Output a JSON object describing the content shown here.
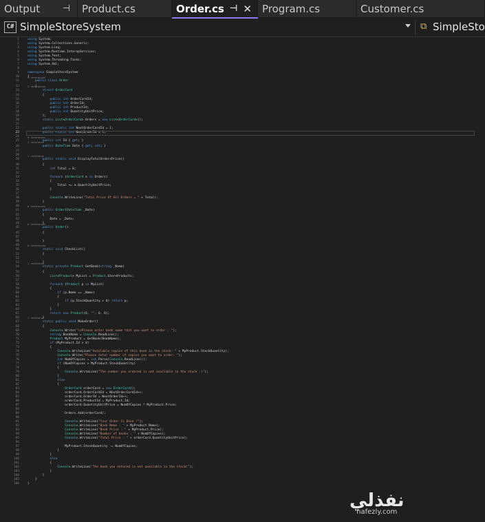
{
  "tabs": [
    {
      "label": "Output",
      "active": false,
      "pin": "⊣",
      "close": ""
    },
    {
      "label": "Product.cs",
      "active": false,
      "pin": "",
      "close": ""
    },
    {
      "label": "Order.cs",
      "active": true,
      "pin": "⊣",
      "close": "✕"
    },
    {
      "label": "Program.cs",
      "active": false,
      "pin": "",
      "close": ""
    },
    {
      "label": "Customer.cs",
      "active": false,
      "pin": "",
      "close": ""
    }
  ],
  "navbar": {
    "project": "SimpleStoreSystem",
    "cs_badge": "C#",
    "class_label": "SimpleStore"
  },
  "watermark": {
    "arabic": "نفذلي",
    "latin": "nafezly.com"
  },
  "current_line": 23,
  "code_lines": [
    {
      "n": 1,
      "t": "using System;"
    },
    {
      "n": 2,
      "t": "using System.Collections.Generic;"
    },
    {
      "n": 3,
      "t": "using System.Linq;"
    },
    {
      "n": 4,
      "t": "using System.Runtime.InteropServices;"
    },
    {
      "n": 5,
      "t": "using System.Text;"
    },
    {
      "n": 6,
      "t": "using System.Threading.Tasks;"
    },
    {
      "n": 7,
      "t": "using System.Xml;"
    },
    {
      "n": 8,
      "t": ""
    },
    {
      "n": 9,
      "t": "namespace SimpleStoreSystem"
    },
    {
      "n": 10,
      "t": "{"
    },
    {
      "n": 11,
      "t": "    public class Order",
      "h": "9 references"
    },
    {
      "n": 12,
      "t": "    {"
    },
    {
      "n": 13,
      "t": "        struct OrderCard",
      "h": "3 references"
    },
    {
      "n": 14,
      "t": "        {"
    },
    {
      "n": 15,
      "t": "            public int OrderCardId;"
    },
    {
      "n": 16,
      "t": "            public int OrderId;"
    },
    {
      "n": 17,
      "t": "            public int ProductId;"
    },
    {
      "n": 18,
      "t": "            public int QuantityUnitPrice;"
    },
    {
      "n": 19,
      "t": "        };"
    },
    {
      "n": 20,
      "t": "        static List<OrderCard> Orders = new List<OrderCard>();"
    },
    {
      "n": 21,
      "t": ""
    },
    {
      "n": 22,
      "t": "        public static int NextOrderCardId = 1;"
    },
    {
      "n": 23,
      "t": "        public static int NextOrderId = 1;"
    },
    {
      "n": 24,
      "t": ""
    },
    {
      "n": 25,
      "t": "        public int Id { get; }",
      "h": "0 references"
    },
    {
      "n": 26,
      "t": "        public DateTime Date { get; set; }",
      "h": "1 reference"
    },
    {
      "n": 27,
      "t": ""
    },
    {
      "n": 28,
      "t": ""
    },
    {
      "n": 29,
      "t": "        public static void DisplayTotalOrdersPrice()",
      "h": "1 reference"
    },
    {
      "n": 30,
      "t": "        {"
    },
    {
      "n": 31,
      "t": "            int Total = 0;"
    },
    {
      "n": 32,
      "t": ""
    },
    {
      "n": 33,
      "t": "            foreach (OrderCard o in Orders)"
    },
    {
      "n": 34,
      "t": "            {"
    },
    {
      "n": 35,
      "t": "                Total += o.QuantityUnitPrice;"
    },
    {
      "n": 36,
      "t": "            }"
    },
    {
      "n": 37,
      "t": ""
    },
    {
      "n": 38,
      "t": "            Console.WriteLine(\"Total Price Of All Orders = \" + Total);"
    },
    {
      "n": 39,
      "t": "        }"
    },
    {
      "n": 40,
      "t": ""
    },
    {
      "n": 41,
      "t": "        public Order(DateTime _Date)",
      "h": "0 references"
    },
    {
      "n": 42,
      "t": "        {"
    },
    {
      "n": 43,
      "t": "            Date = _Date;"
    },
    {
      "n": 44,
      "t": "        }"
    },
    {
      "n": 45,
      "t": "        public Order()",
      "h": "0 references"
    },
    {
      "n": 46,
      "t": "        {"
    },
    {
      "n": 47,
      "t": ""
    },
    {
      "n": 48,
      "t": "        }"
    },
    {
      "n": 49,
      "t": ""
    },
    {
      "n": 50,
      "t": "        static void CheckList()",
      "h": "0 references"
    },
    {
      "n": 51,
      "t": "        {"
    },
    {
      "n": 52,
      "t": ""
    },
    {
      "n": 53,
      "t": "        }"
    },
    {
      "n": 54,
      "t": "        static private Product GetBook(string _Name)",
      "h": "1 reference"
    },
    {
      "n": 55,
      "t": "        {"
    },
    {
      "n": 56,
      "t": "            List<Product> MyList = Product.StoreProducts;"
    },
    {
      "n": 57,
      "t": ""
    },
    {
      "n": 58,
      "t": "            foreach (Product p in MyList)"
    },
    {
      "n": 59,
      "t": "            {"
    },
    {
      "n": 60,
      "t": "                if (p.Name == _Name)"
    },
    {
      "n": 61,
      "t": "                {"
    },
    {
      "n": 62,
      "t": "                    if (p.StockQuantity > 0) return p;"
    },
    {
      "n": 63,
      "t": "                }"
    },
    {
      "n": 64,
      "t": "            }"
    },
    {
      "n": 65,
      "t": "            return new Product(0, \"\", 0, 0);"
    },
    {
      "n": 66,
      "t": "        }"
    },
    {
      "n": 67,
      "t": "        static public void MakeOrder()",
      "h": "1 reference"
    },
    {
      "n": 68,
      "t": "        {"
    },
    {
      "n": 69,
      "t": "            Console.Write(\"\\nPlease enter book name that you want to order : \");"
    },
    {
      "n": 70,
      "t": "            string BookName = Console.ReadLine();"
    },
    {
      "n": 71,
      "t": "            Product MyProduct = GetBook(BookName);"
    },
    {
      "n": 72,
      "t": "            if (MyProduct.Id > 0)"
    },
    {
      "n": 73,
      "t": "            {"
    },
    {
      "n": 74,
      "t": "                Console.WriteLine(\"Available copies of this book in the stock: \" + MyProduct.StockQuantity);"
    },
    {
      "n": 75,
      "t": "                Console.Write(\"Please enter number of copies you want to order: \");"
    },
    {
      "n": 76,
      "t": "                int NumOfCopies = int.Parse(Console.ReadLine());"
    },
    {
      "n": 77,
      "t": "                if (NumOfCopies > MyProduct.StockQuantity)"
    },
    {
      "n": 78,
      "t": "                {"
    },
    {
      "n": 79,
      "t": "                    Console.WriteLine(\"The number you ordered is not available in the stock :(\");"
    },
    {
      "n": 80,
      "t": "                }"
    },
    {
      "n": 81,
      "t": "                else"
    },
    {
      "n": 82,
      "t": "                {"
    },
    {
      "n": 83,
      "t": "                    OrderCard orderCard = new OrderCard();"
    },
    {
      "n": 84,
      "t": "                    orderCard.OrderCardId = NextOrderCardId++;"
    },
    {
      "n": 85,
      "t": "                    orderCard.OrderId = NextOrderId++;"
    },
    {
      "n": 86,
      "t": "                    orderCard.ProductId = MyProduct.Id;"
    },
    {
      "n": 87,
      "t": "                    orderCard.QuantityUnitPrice = NumOfCopies * MyProduct.Price;"
    },
    {
      "n": 88,
      "t": ""
    },
    {
      "n": 89,
      "t": "                    Orders.Add(orderCard);"
    },
    {
      "n": 90,
      "t": ""
    },
    {
      "n": 91,
      "t": "                    Console.WriteLine(\"Your Order Is Done !\");"
    },
    {
      "n": 92,
      "t": "                    Console.WriteLine(\"Book Name : \" + MyProduct.Name);"
    },
    {
      "n": 93,
      "t": "                    Console.WriteLine(\"Book Price : \" + MyProduct.Price);"
    },
    {
      "n": 94,
      "t": "                    Console.WriteLine(\"Number of books : \" + NumOfCopies);"
    },
    {
      "n": 95,
      "t": "                    Console.WriteLine(\"Total Price : \" + orderCard.QuantityUnitPrice);"
    },
    {
      "n": 96,
      "t": ""
    },
    {
      "n": 97,
      "t": "                    MyProduct.StockQuantity -= NumOfCopies;"
    },
    {
      "n": 98,
      "t": "                }"
    },
    {
      "n": 99,
      "t": "            }"
    },
    {
      "n": 100,
      "t": "            else"
    },
    {
      "n": 101,
      "t": "            {"
    },
    {
      "n": 102,
      "t": "                Console.WriteLine(\"The book you entered is not available in the stock!\");"
    },
    {
      "n": 103,
      "t": "            }"
    },
    {
      "n": 104,
      "t": "        }"
    },
    {
      "n": 105,
      "t": "    }"
    },
    {
      "n": 106,
      "t": "}"
    }
  ]
}
